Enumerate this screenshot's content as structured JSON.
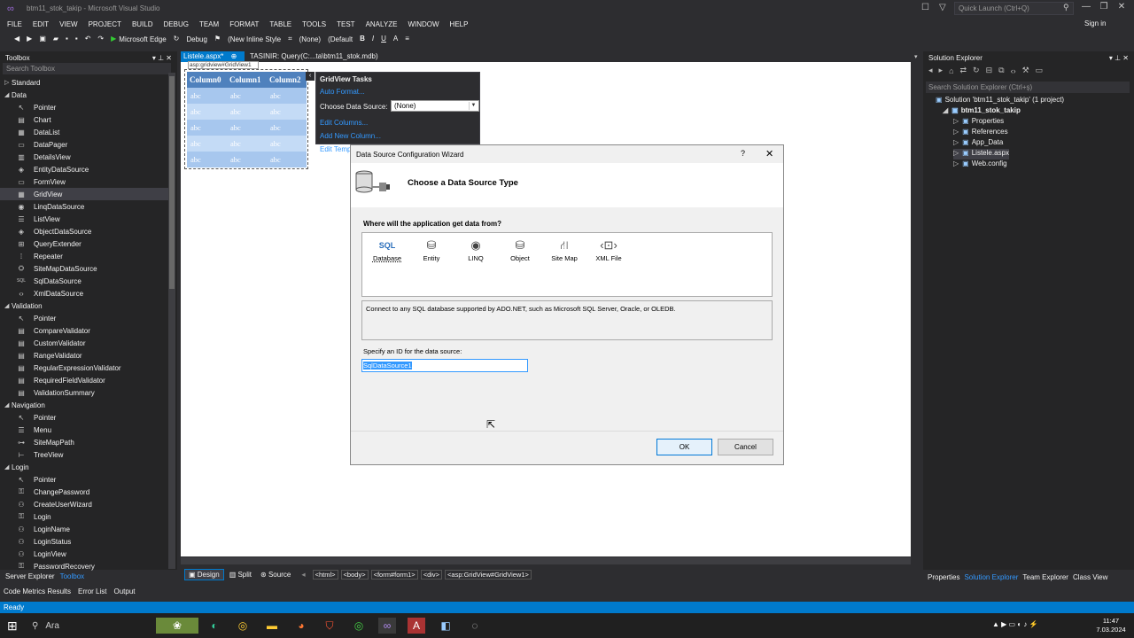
{
  "window": {
    "title": "btm11_stok_takip - Microsoft Visual Studio",
    "quick_launch": "Quick Launch (Ctrl+Q)",
    "sign_in": "Sign in"
  },
  "menu": [
    "FILE",
    "EDIT",
    "VIEW",
    "PROJECT",
    "BUILD",
    "DEBUG",
    "TEAM",
    "FORMAT",
    "TABLE",
    "TOOLS",
    "TEST",
    "ANALYZE",
    "WINDOW",
    "HELP"
  ],
  "toolbar": {
    "browser": "Microsoft Edge",
    "config": "Debug",
    "style": "(New Inline Style",
    "target": "(None)",
    "font": "(Default"
  },
  "toolbox": {
    "title": "Toolbox",
    "search_placeholder": "Search Toolbox",
    "items": [
      {
        "cat": true,
        "label": "Standard",
        "open": false
      },
      {
        "cat": true,
        "label": "Data",
        "open": true
      },
      {
        "label": "Pointer",
        "icon": "↖"
      },
      {
        "label": "Chart",
        "icon": "▤"
      },
      {
        "label": "DataList",
        "icon": "▦"
      },
      {
        "label": "DataPager",
        "icon": "▭"
      },
      {
        "label": "DetailsView",
        "icon": "▥"
      },
      {
        "label": "EntityDataSource",
        "icon": "◈"
      },
      {
        "label": "FormView",
        "icon": "▭"
      },
      {
        "label": "GridView",
        "icon": "▦",
        "selected": true
      },
      {
        "label": "LinqDataSource",
        "icon": "◉"
      },
      {
        "label": "ListView",
        "icon": "☰"
      },
      {
        "label": "ObjectDataSource",
        "icon": "◈"
      },
      {
        "label": "QueryExtender",
        "icon": "⊞"
      },
      {
        "label": "Repeater",
        "icon": "⁞"
      },
      {
        "label": "SiteMapDataSource",
        "icon": "⛭"
      },
      {
        "label": "SqlDataSource",
        "icon": "SQL"
      },
      {
        "label": "XmlDataSource",
        "icon": "‹›"
      },
      {
        "cat": true,
        "label": "Validation",
        "open": true
      },
      {
        "label": "Pointer",
        "icon": "↖"
      },
      {
        "label": "CompareValidator",
        "icon": "▤"
      },
      {
        "label": "CustomValidator",
        "icon": "▤"
      },
      {
        "label": "RangeValidator",
        "icon": "▤"
      },
      {
        "label": "RegularExpressionValidator",
        "icon": "▤"
      },
      {
        "label": "RequiredFieldValidator",
        "icon": "▤"
      },
      {
        "label": "ValidationSummary",
        "icon": "▤"
      },
      {
        "cat": true,
        "label": "Navigation",
        "open": true
      },
      {
        "label": "Pointer",
        "icon": "↖"
      },
      {
        "label": "Menu",
        "icon": "☰"
      },
      {
        "label": "SiteMapPath",
        "icon": "⊶"
      },
      {
        "label": "TreeView",
        "icon": "⊢"
      },
      {
        "cat": true,
        "label": "Login",
        "open": true
      },
      {
        "label": "Pointer",
        "icon": "↖"
      },
      {
        "label": "ChangePassword",
        "icon": "⚿"
      },
      {
        "label": "CreateUserWizard",
        "icon": "⚇"
      },
      {
        "label": "Login",
        "icon": "⚿"
      },
      {
        "label": "LoginName",
        "icon": "⚇"
      },
      {
        "label": "LoginStatus",
        "icon": "⚇"
      },
      {
        "label": "LoginView",
        "icon": "⚇"
      },
      {
        "label": "PasswordRecovery",
        "icon": "⚿"
      }
    ]
  },
  "tabs": {
    "active": "Listele.aspx*",
    "other": "TASINIR: Query(C:...ta\\btm11_stok.mdb)"
  },
  "grid": {
    "tag": "asp:gridview#GridView1",
    "headers": [
      "Column0",
      "Column1",
      "Column2"
    ],
    "rows": [
      [
        "abc",
        "abc",
        "abc"
      ],
      [
        "abc",
        "abc",
        "abc"
      ],
      [
        "abc",
        "abc",
        "abc"
      ],
      [
        "abc",
        "abc",
        "abc"
      ],
      [
        "abc",
        "abc",
        "abc"
      ]
    ]
  },
  "tasks": {
    "title": "GridView Tasks",
    "auto_format": "Auto Format...",
    "choose_label": "Choose Data Source:",
    "choose_value": "(None)",
    "edit_columns": "Edit Columns...",
    "add_column": "Add New Column...",
    "edit_templates": "Edit Templ"
  },
  "dialog": {
    "title": "Data Source Configuration Wizard",
    "help": "?",
    "heading": "Choose a Data Source Type",
    "question": "Where will the application get data from?",
    "types": [
      {
        "label": "Database",
        "icon": "SQL",
        "selected": true
      },
      {
        "label": "Entity",
        "icon": "⛁"
      },
      {
        "label": "LINQ",
        "icon": "◉"
      },
      {
        "label": "Object",
        "icon": "⛁"
      },
      {
        "label": "Site Map",
        "icon": "⛙"
      },
      {
        "label": "XML File",
        "icon": "‹⊡›"
      }
    ],
    "description": "Connect to any SQL database supported by ADO.NET, such as Microsoft SQL Server, Oracle, or OLEDB.",
    "id_label": "Specify an ID for the data source:",
    "id_value": "SqlDataSource1",
    "ok": "OK",
    "cancel": "Cancel"
  },
  "designer": {
    "views": [
      "Design",
      "Split",
      "Source"
    ],
    "crumbs": [
      "<html>",
      "<body>",
      "<form#form1>",
      "<div>",
      "<asp:GridView#GridView1>"
    ]
  },
  "solution": {
    "title": "Solution Explorer",
    "search_placeholder": "Search Solution Explorer (Ctrl+ş)",
    "items": [
      {
        "label": "Solution 'btm11_stok_takip' (1 project)",
        "indent": 0
      },
      {
        "label": "btm11_stok_takip",
        "indent": 1,
        "bold": true
      },
      {
        "label": "Properties",
        "indent": 2
      },
      {
        "label": "References",
        "indent": 2
      },
      {
        "label": "App_Data",
        "indent": 2
      },
      {
        "label": "Listele.aspx",
        "indent": 2,
        "selected": true
      },
      {
        "label": "Web.config",
        "indent": 2
      }
    ]
  },
  "bottom": {
    "left_tabs": [
      "Server Explorer",
      "Toolbox"
    ],
    "output_tabs": [
      "Code Metrics Results",
      "Error List",
      "Output"
    ],
    "right_tabs": [
      "Properties",
      "Solution Explorer",
      "Team Explorer",
      "Class View"
    ]
  },
  "status": "Ready",
  "taskbar": {
    "search": "Ara",
    "time": "11:47",
    "date": "7.03.2024"
  }
}
